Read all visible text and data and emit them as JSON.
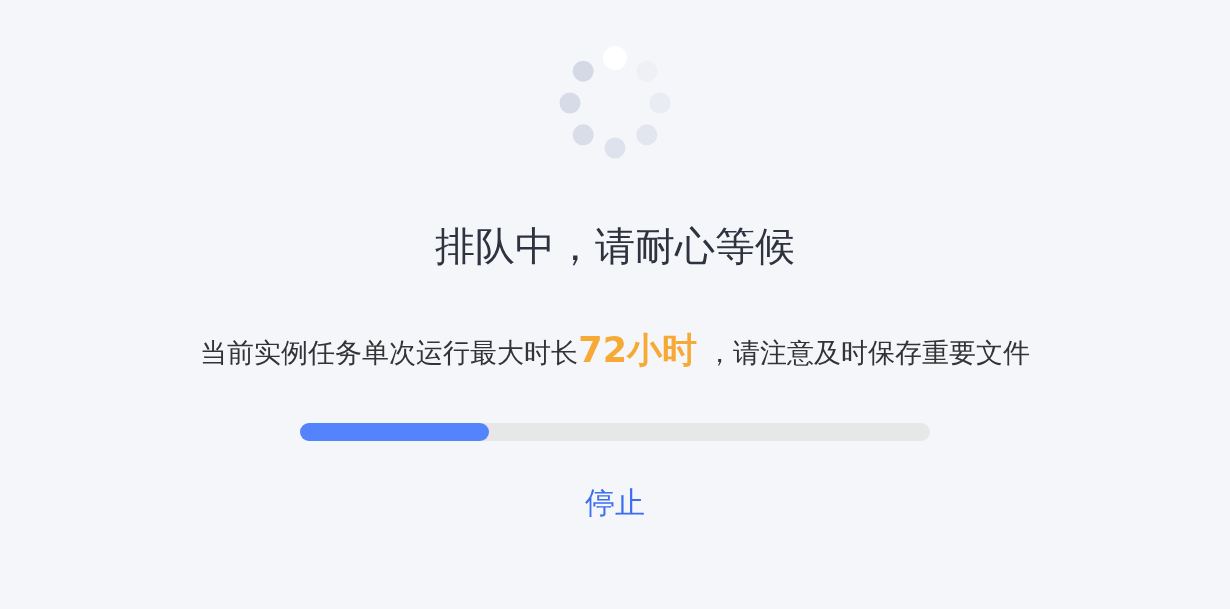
{
  "status": {
    "title": "排队中，请耐心等候",
    "notice": "当前实例任务单次运行最大时长**72小时** ，请注意及时保存重要文件"
  },
  "progress": {
    "level": 0.3
  },
  "actions": [
    {
      "label": "停止"
    }
  ]
}
